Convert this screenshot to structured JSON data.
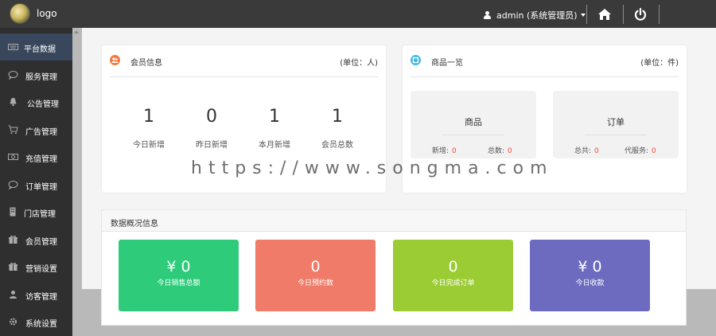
{
  "header": {
    "logo_text": "logo",
    "user_label": "admin (系统管理员)"
  },
  "sidebar": {
    "items": [
      {
        "label": "平台数据",
        "icon": "keyboard-icon"
      },
      {
        "label": "服务管理",
        "icon": "comment-icon"
      },
      {
        "label": "公告管理",
        "icon": "bell-icon"
      },
      {
        "label": "广告管理",
        "icon": "cart-icon"
      },
      {
        "label": "充值管理",
        "icon": "money-icon"
      },
      {
        "label": "订单管理",
        "icon": "comment-icon"
      },
      {
        "label": "门店管理",
        "icon": "building-icon"
      },
      {
        "label": "会员管理",
        "icon": "gift-icon"
      },
      {
        "label": "营销设置",
        "icon": "gift-icon"
      },
      {
        "label": "访客管理",
        "icon": "user-icon"
      },
      {
        "label": "系统设置",
        "icon": "gear-icon"
      }
    ]
  },
  "member_card": {
    "title": "会员信息",
    "unit": "(单位：人)",
    "stats": [
      {
        "value": "1",
        "label": "今日新增"
      },
      {
        "value": "0",
        "label": "昨日新增"
      },
      {
        "value": "1",
        "label": "本月新增"
      },
      {
        "value": "1",
        "label": "会员总数"
      }
    ]
  },
  "goods_card": {
    "title": "商品一览",
    "unit": "(单位：件)",
    "goods": {
      "title": "商品",
      "new_label": "新增:",
      "new_value": "0",
      "total_label": "总数:",
      "total_value": "0"
    },
    "orders": {
      "title": "订单",
      "total_label": "总共:",
      "total_value": "0",
      "pending_label": "代服务:",
      "pending_value": "0"
    }
  },
  "overview": {
    "title": "数据概况信息",
    "tiles": [
      {
        "value": "¥ 0",
        "label": "今日销售总额",
        "color": "#2ecc7a"
      },
      {
        "value": "0",
        "label": "今日预约数",
        "color": "#f07b68"
      },
      {
        "value": "0",
        "label": "今日完成订单",
        "color": "#9ccc34"
      },
      {
        "value": "¥ 0",
        "label": "今日收款",
        "color": "#6c6bbf"
      }
    ]
  },
  "watermark": "https://www.songma.com",
  "colors": {
    "topbar": "#3a3a3a",
    "sidebar": "#2f2f2f",
    "sidebar_active": "#39475d",
    "highlight_red": "#e74c3c"
  }
}
